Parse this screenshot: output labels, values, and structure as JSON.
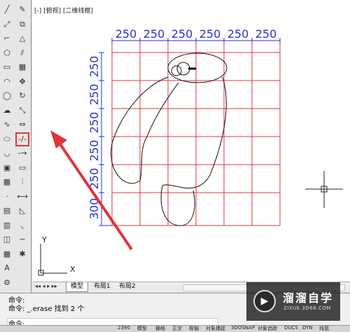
{
  "viewport_label": "[-] [俯视] [二维线框]",
  "dimensions": {
    "top": [
      "250",
      "250",
      "250",
      "250",
      "250",
      "250"
    ],
    "left": [
      "250",
      "250",
      "250",
      "250",
      "250",
      "300"
    ]
  },
  "ucs": {
    "x_label": "X",
    "y_label": "Y"
  },
  "tabs": {
    "model": "模型",
    "layout1": "布局1",
    "layout2": "布局2"
  },
  "nav_arrows": "◂◂ ◂ ▸ ▸▸",
  "command": {
    "line1": "命令:",
    "line2": "命令:  _.erase 找到 2 个",
    "prompt": "命令:"
  },
  "toolbar1_icons": [
    "line-icon",
    "construction-line-icon",
    "polyline-icon",
    "polygon-icon",
    "rectangle-icon",
    "arc-icon",
    "circle-icon",
    "revision-cloud-icon",
    "spline-icon",
    "ellipse-icon",
    "ellipse-arc-icon",
    "insert-block-icon",
    "make-block-icon",
    "point-icon",
    "hatch-icon",
    "gradient-icon",
    "region-icon",
    "table-icon",
    "mtext-icon",
    "add-selected-icon"
  ],
  "toolbar2_icons": [
    "erase-icon",
    "copy-icon",
    "mirror-icon",
    "offset-icon",
    "array-icon",
    "move-icon",
    "rotate-icon",
    "scale-icon",
    "stretch-icon",
    "trim-icon",
    "extend-icon",
    "break-at-point-icon",
    "break-icon",
    "join-icon",
    "chamfer-icon",
    "fillet-icon",
    "blend-curves-icon",
    "explode-icon"
  ],
  "toolbar1_glyphs": [
    "╱",
    "⤢",
    "⌐",
    "⬠",
    "▭",
    "◠",
    "◯",
    "☁",
    "∿",
    "⬭",
    "◡",
    "▣",
    "▦",
    "·",
    "▤",
    "▥",
    "◫",
    "▦",
    "A",
    "⚙"
  ],
  "toolbar2_glyphs": [
    "✎",
    "⧉",
    "△",
    "⫽",
    "▦",
    "✥",
    "↻",
    "⤡",
    "⇔",
    "-/-",
    "-→",
    "▭",
    "⫶",
    "⟷",
    "◺",
    "◟",
    "∼",
    "✱"
  ],
  "selected_tool_index": 9,
  "watermark": {
    "title": "溜溜自学",
    "subtitle": "ZIXUE.3D66.COM",
    "logo_glyph": "▶"
  },
  "status_items": [
    "2390",
    "模型",
    "栅格",
    "正交",
    "极轴",
    "对象捕捉",
    "3DOSNAP",
    "对象追踪",
    "DUCS",
    "DYN",
    "线宽"
  ],
  "colors": {
    "grid": "#e0343c",
    "dimension": "#2a2fd0",
    "annotation_arrow": "#e0343c",
    "viewport_bg": "#ffffff"
  }
}
